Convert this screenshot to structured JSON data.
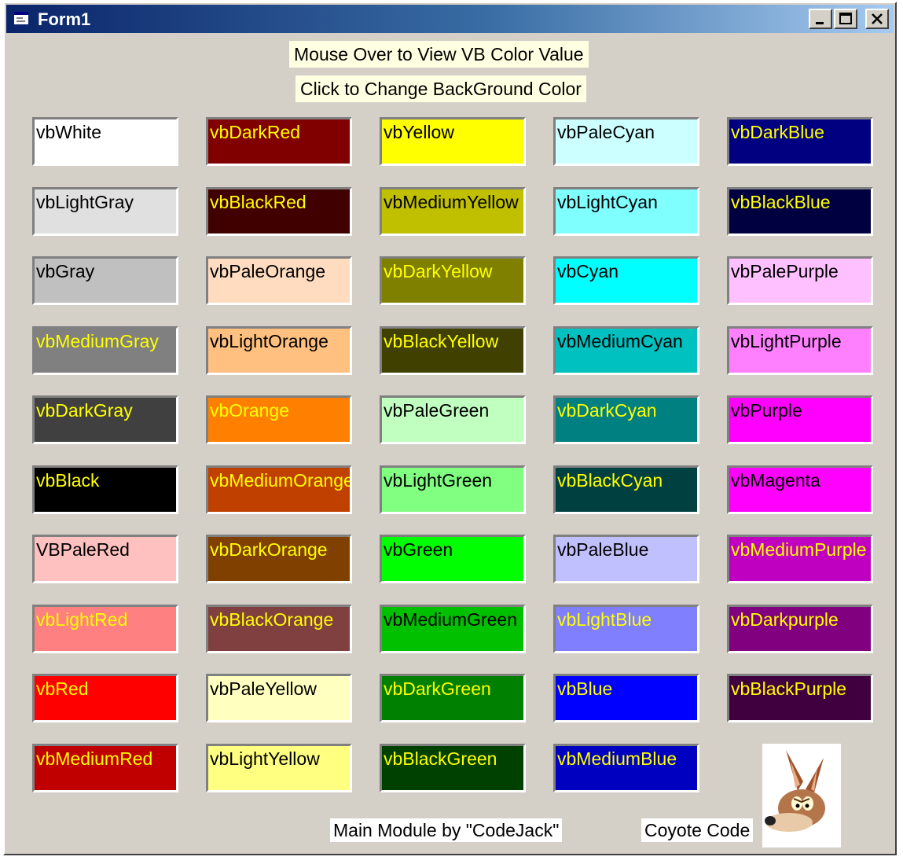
{
  "window": {
    "title": "Form1"
  },
  "hints": {
    "mouse_over": "Mouse Over to View VB Color Value",
    "click_change": "Click to Change BackGround Color"
  },
  "swatches": [
    {
      "label": "vbWhite",
      "bg": "#ffffff",
      "fg": "#000000"
    },
    {
      "label": "vbDarkRed",
      "bg": "#800000",
      "fg": "#ffff00"
    },
    {
      "label": "vbYellow",
      "bg": "#ffff00",
      "fg": "#000000"
    },
    {
      "label": "vbPaleCyan",
      "bg": "#ccffff",
      "fg": "#000000"
    },
    {
      "label": "vbDarkBlue",
      "bg": "#000080",
      "fg": "#ffff00"
    },
    {
      "label": "vbLightGray",
      "bg": "#e0e0e0",
      "fg": "#000000"
    },
    {
      "label": "vbBlackRed",
      "bg": "#400000",
      "fg": "#ffff00"
    },
    {
      "label": "vbMediumYellow",
      "bg": "#c0c000",
      "fg": "#000000"
    },
    {
      "label": "vbLightCyan",
      "bg": "#80ffff",
      "fg": "#000000"
    },
    {
      "label": "vbBlackBlue",
      "bg": "#000040",
      "fg": "#ffff00"
    },
    {
      "label": "vbGray",
      "bg": "#c0c0c0",
      "fg": "#000000"
    },
    {
      "label": "vbPaleOrange",
      "bg": "#ffdcc0",
      "fg": "#000000"
    },
    {
      "label": "vbDarkYellow",
      "bg": "#808000",
      "fg": "#ffff00"
    },
    {
      "label": "vbCyan",
      "bg": "#00ffff",
      "fg": "#000000"
    },
    {
      "label": "vbPalePurple",
      "bg": "#ffc0ff",
      "fg": "#000000"
    },
    {
      "label": "vbMediumGray",
      "bg": "#808080",
      "fg": "#ffff00"
    },
    {
      "label": "vbLightOrange",
      "bg": "#ffc080",
      "fg": "#000000"
    },
    {
      "label": "vbBlackYellow",
      "bg": "#404000",
      "fg": "#ffff00"
    },
    {
      "label": "vbMediumCyan",
      "bg": "#00c0c0",
      "fg": "#000000"
    },
    {
      "label": "vbLightPurple",
      "bg": "#ff80ff",
      "fg": "#000000"
    },
    {
      "label": "vbDarkGray",
      "bg": "#404040",
      "fg": "#ffff00"
    },
    {
      "label": "vbOrange",
      "bg": "#ff8000",
      "fg": "#ffff00"
    },
    {
      "label": "vbPaleGreen",
      "bg": "#c0ffc0",
      "fg": "#000000"
    },
    {
      "label": "vbDarkCyan",
      "bg": "#008080",
      "fg": "#ffff00"
    },
    {
      "label": "vbPurple",
      "bg": "#ff00ff",
      "fg": "#000000"
    },
    {
      "label": "vbBlack",
      "bg": "#000000",
      "fg": "#ffff00"
    },
    {
      "label": "vbMediumOrange",
      "bg": "#c04000",
      "fg": "#ffff00"
    },
    {
      "label": "vbLightGreen",
      "bg": "#80ff80",
      "fg": "#000000"
    },
    {
      "label": "vbBlackCyan",
      "bg": "#004040",
      "fg": "#ffff00"
    },
    {
      "label": "vbMagenta",
      "bg": "#ff00ff",
      "fg": "#000000"
    },
    {
      "label": "VBPaleRed",
      "bg": "#ffc0c0",
      "fg": "#000000"
    },
    {
      "label": "vbDarkOrange",
      "bg": "#804000",
      "fg": "#ffff00"
    },
    {
      "label": "vbGreen",
      "bg": "#00ff00",
      "fg": "#000000"
    },
    {
      "label": "vbPaleBlue",
      "bg": "#c0c0ff",
      "fg": "#000000"
    },
    {
      "label": "vbMediumPurple",
      "bg": "#c000c0",
      "fg": "#ffff00"
    },
    {
      "label": "vbLightRed",
      "bg": "#ff8080",
      "fg": "#ffff00"
    },
    {
      "label": "vbBlackOrange",
      "bg": "#804040",
      "fg": "#ffff00"
    },
    {
      "label": "vbMediumGreen",
      "bg": "#00c000",
      "fg": "#000000"
    },
    {
      "label": "vbLightBlue",
      "bg": "#8080ff",
      "fg": "#ffff00"
    },
    {
      "label": "vbDarkpurple",
      "bg": "#800080",
      "fg": "#ffff00"
    },
    {
      "label": "vbRed",
      "bg": "#ff0000",
      "fg": "#ffff00"
    },
    {
      "label": "vbPaleYellow",
      "bg": "#ffffc0",
      "fg": "#000000"
    },
    {
      "label": "vbDarkGreen",
      "bg": "#008000",
      "fg": "#ffff00"
    },
    {
      "label": "vbBlue",
      "bg": "#0000ff",
      "fg": "#ffff00"
    },
    {
      "label": "vbBlackPurple",
      "bg": "#400040",
      "fg": "#ffff00"
    },
    {
      "label": "vbMediumRed",
      "bg": "#c00000",
      "fg": "#ffff00"
    },
    {
      "label": "vbLightYellow",
      "bg": "#ffff80",
      "fg": "#000000"
    },
    {
      "label": "vbBlackGreen",
      "bg": "#004000",
      "fg": "#ffff00"
    },
    {
      "label": "vbMediumBlue",
      "bg": "#0000c0",
      "fg": "#ffff00"
    }
  ],
  "footer": {
    "credit": "Main Module by \"CodeJack\"",
    "coyote_label": "Coyote Code"
  },
  "icons": {
    "app": "form-icon",
    "minimize": "minimize-icon",
    "maximize": "maximize-icon",
    "close": "close-icon",
    "logo": "coyote-logo"
  }
}
